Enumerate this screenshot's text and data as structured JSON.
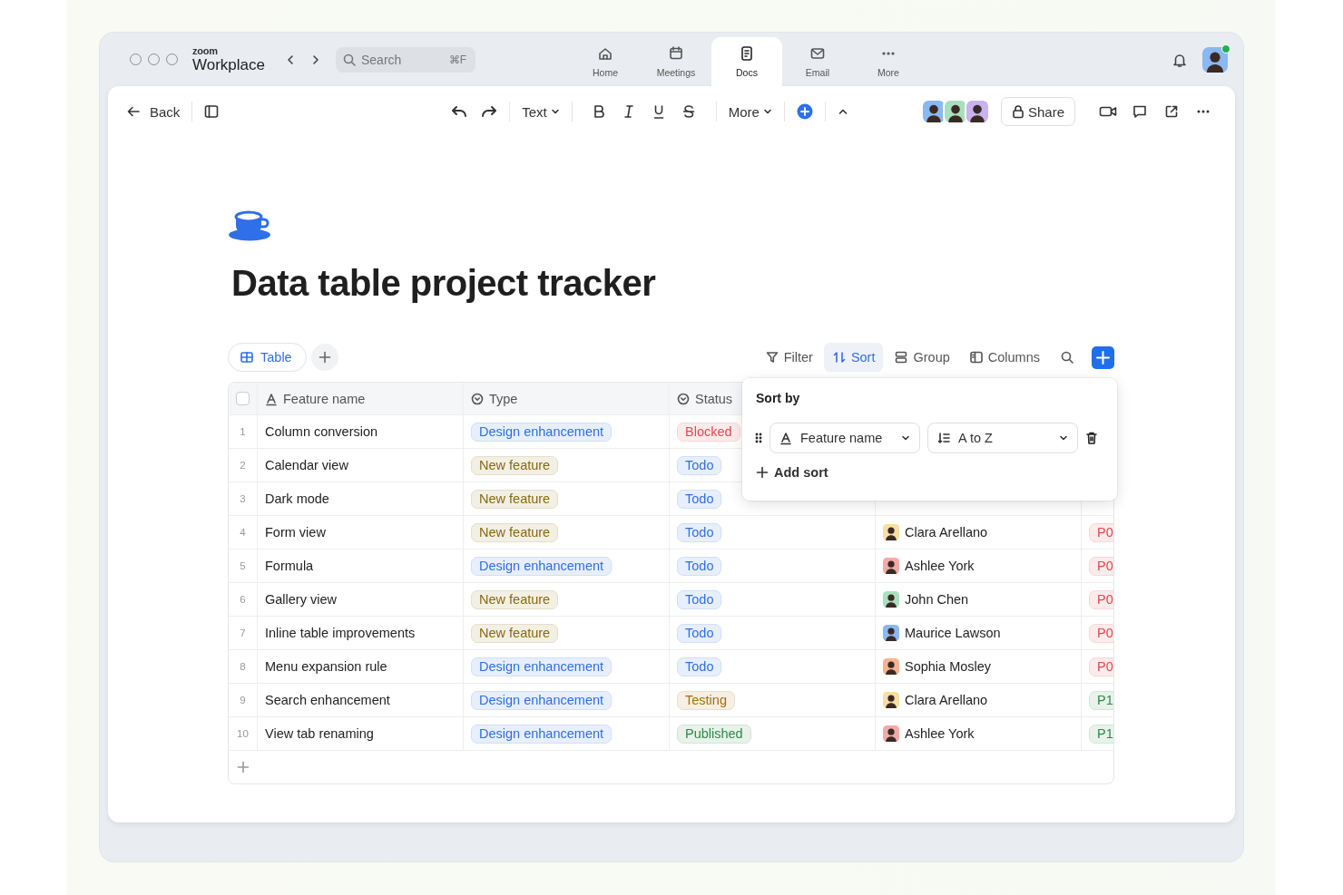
{
  "app": {
    "brand_small": "zoom",
    "brand": "Workplace"
  },
  "search": {
    "placeholder": "Search",
    "shortcut": "⌘F"
  },
  "nav_tabs": [
    {
      "label": "Home",
      "kind": "home",
      "selected": false
    },
    {
      "label": "Meetings",
      "kind": "calendar",
      "selected": false
    },
    {
      "label": "Docs",
      "kind": "doc",
      "selected": true
    },
    {
      "label": "Email",
      "kind": "mail",
      "selected": false
    },
    {
      "label": "More",
      "kind": "more",
      "selected": false
    }
  ],
  "user": {
    "color": "#8ab8f0",
    "online": true
  },
  "toolbar": {
    "back": "Back",
    "text_style": "Text",
    "more": "More",
    "share": "Share"
  },
  "collaborators": [
    {
      "color": "#8ab8f0"
    },
    {
      "color": "#a8e0bd"
    },
    {
      "color": "#c9b2f0"
    }
  ],
  "document": {
    "title": "Data table project tracker"
  },
  "views": [
    {
      "label": "Table",
      "selected": true
    }
  ],
  "view_actions": [
    {
      "label": "Filter",
      "kind": "filter",
      "selected": false
    },
    {
      "label": "Sort",
      "kind": "sort",
      "selected": true
    },
    {
      "label": "Group",
      "kind": "group",
      "selected": false
    },
    {
      "label": "Columns",
      "kind": "columns",
      "selected": false
    }
  ],
  "table": {
    "select_all": {
      "checked": false
    },
    "columns": [
      {
        "label": "Feature name",
        "kind": "text"
      },
      {
        "label": "Type",
        "kind": "select"
      },
      {
        "label": "Status",
        "kind": "select"
      }
    ],
    "rows": [
      {
        "number": "1",
        "name": "Column conversion",
        "type": {
          "label": "Design enhancement",
          "color": "#2f6fe8"
        },
        "status": {
          "label": "Blocked",
          "color": "#e5484d"
        }
      },
      {
        "number": "2",
        "name": "Calendar view",
        "type": {
          "label": "New feature",
          "color": "#8a6a0c"
        },
        "status": {
          "label": "Todo",
          "color": "#2f6fe8"
        }
      },
      {
        "number": "3",
        "name": "Dark mode",
        "type": {
          "label": "New feature",
          "color": "#8a6a0c"
        },
        "status": {
          "label": "Todo",
          "color": "#2f6fe8"
        }
      },
      {
        "number": "4",
        "name": "Form view",
        "type": {
          "label": "New feature",
          "color": "#8a6a0c"
        },
        "status": {
          "label": "Todo",
          "color": "#2f6fe8"
        },
        "assignee": {
          "name": "Clara Arellano",
          "color": "#f6dfa0"
        },
        "priority": {
          "label": "P0",
          "color": "#e5484d"
        }
      },
      {
        "number": "5",
        "name": "Formula",
        "type": {
          "label": "Design enhancement",
          "color": "#2f6fe8"
        },
        "status": {
          "label": "Todo",
          "color": "#2f6fe8"
        },
        "assignee": {
          "name": "Ashlee York",
          "color": "#f4a9a6"
        },
        "priority": {
          "label": "P0",
          "color": "#e5484d"
        }
      },
      {
        "number": "6",
        "name": "Gallery view",
        "type": {
          "label": "New feature",
          "color": "#8a6a0c"
        },
        "status": {
          "label": "Todo",
          "color": "#2f6fe8"
        },
        "assignee": {
          "name": "John Chen",
          "color": "#a8e0bd"
        },
        "priority": {
          "label": "P0",
          "color": "#e5484d"
        }
      },
      {
        "number": "7",
        "name": "Inline table improvements",
        "type": {
          "label": "New feature",
          "color": "#8a6a0c"
        },
        "status": {
          "label": "Todo",
          "color": "#2f6fe8"
        },
        "assignee": {
          "name": "Maurice Lawson",
          "color": "#8ab8f0"
        },
        "priority": {
          "label": "P0",
          "color": "#e5484d"
        }
      },
      {
        "number": "8",
        "name": "Menu expansion rule",
        "type": {
          "label": "Design enhancement",
          "color": "#2f6fe8"
        },
        "status": {
          "label": "Todo",
          "color": "#2f6fe8"
        },
        "assignee": {
          "name": "Sophia Mosley",
          "color": "#f5b38f"
        },
        "priority": {
          "label": "P0",
          "color": "#e5484d"
        }
      },
      {
        "number": "9",
        "name": "Search enhancement",
        "type": {
          "label": "Design enhancement",
          "color": "#2f6fe8"
        },
        "status": {
          "label": "Testing",
          "color": "#a86e08"
        },
        "assignee": {
          "name": "Clara Arellano",
          "color": "#f6dfa0"
        },
        "priority": {
          "label": "P1",
          "color": "#2f8a46"
        }
      },
      {
        "number": "10",
        "name": "View tab renaming",
        "type": {
          "label": "Design enhancement",
          "color": "#2f6fe8"
        },
        "status": {
          "label": "Published",
          "color": "#2f8a46"
        },
        "assignee": {
          "name": "Ashlee York",
          "color": "#f4a9a6"
        },
        "priority": {
          "label": "P1",
          "color": "#2f8a46"
        }
      }
    ]
  },
  "sort_popover": {
    "title": "Sort by",
    "rules": [
      {
        "field": "Feature name",
        "order": "A to Z"
      }
    ],
    "add": "Add sort"
  }
}
